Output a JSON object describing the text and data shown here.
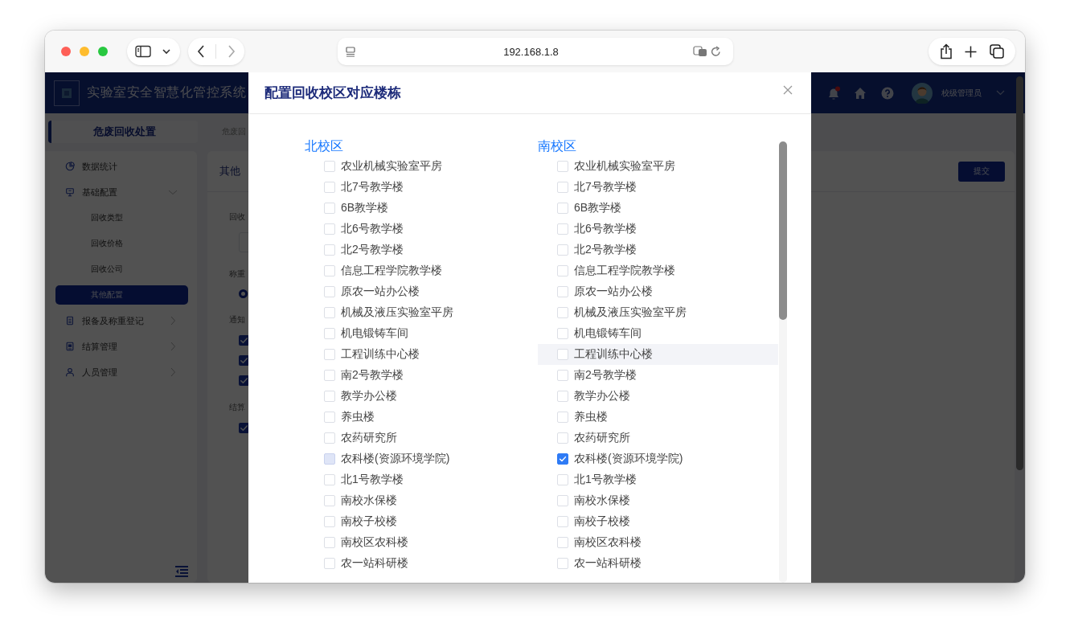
{
  "browser": {
    "url": "192.168.1.8"
  },
  "app": {
    "title": "实验室安全智慧化管控系统",
    "user": "校级管理员"
  },
  "sidebar": {
    "tab": "危废回收处置",
    "items": [
      {
        "label": "数据统计",
        "kind": "link",
        "selected": false
      },
      {
        "label": "基础配置",
        "kind": "group",
        "expanded": true,
        "selected": false,
        "children": [
          {
            "label": "回收类型",
            "selected": false
          },
          {
            "label": "回收价格",
            "selected": false
          },
          {
            "label": "回收公司",
            "selected": false
          },
          {
            "label": "其他配置",
            "selected": true
          }
        ]
      },
      {
        "label": "报备及称重登记",
        "kind": "group",
        "expanded": false,
        "selected": false
      },
      {
        "label": "结算管理",
        "kind": "group",
        "expanded": false,
        "selected": false
      },
      {
        "label": "人员管理",
        "kind": "group",
        "expanded": false,
        "selected": false
      }
    ]
  },
  "main": {
    "breadcrumb": "危废回",
    "card_title": "其他",
    "submit": "提交",
    "form": [
      {
        "label": "回收",
        "kind": "input"
      },
      {
        "label": "称重",
        "kind": "radio",
        "options": [
          {
            "selected": true
          }
        ]
      },
      {
        "label": "通知",
        "kind": "checkbox",
        "options": [
          {
            "checked": true
          },
          {
            "checked": true
          },
          {
            "checked": true
          }
        ]
      },
      {
        "label": "结算",
        "kind": "checkbox",
        "options": [
          {
            "checked": true
          }
        ]
      }
    ]
  },
  "dialog": {
    "title": "配置回收校区对应楼栋",
    "campuses": [
      {
        "name": "北校区",
        "buildings": [
          {
            "label": "农业机械实验室平房",
            "checked": false,
            "disabled": false,
            "hovered": false
          },
          {
            "label": "北7号教学楼",
            "checked": false,
            "disabled": false,
            "hovered": false
          },
          {
            "label": "6B教学楼",
            "checked": false,
            "disabled": false,
            "hovered": false
          },
          {
            "label": "北6号教学楼",
            "checked": false,
            "disabled": false,
            "hovered": false
          },
          {
            "label": "北2号教学楼",
            "checked": false,
            "disabled": false,
            "hovered": false
          },
          {
            "label": "信息工程学院教学楼",
            "checked": false,
            "disabled": false,
            "hovered": false
          },
          {
            "label": "原农一站办公楼",
            "checked": false,
            "disabled": false,
            "hovered": false
          },
          {
            "label": "机械及液压实验室平房",
            "checked": false,
            "disabled": false,
            "hovered": false
          },
          {
            "label": "机电锻铸车间",
            "checked": false,
            "disabled": false,
            "hovered": false
          },
          {
            "label": "工程训练中心楼",
            "checked": false,
            "disabled": false,
            "hovered": false
          },
          {
            "label": "南2号教学楼",
            "checked": false,
            "disabled": false,
            "hovered": false
          },
          {
            "label": "教学办公楼",
            "checked": false,
            "disabled": false,
            "hovered": false
          },
          {
            "label": "养虫楼",
            "checked": false,
            "disabled": false,
            "hovered": false
          },
          {
            "label": "农药研究所",
            "checked": false,
            "disabled": false,
            "hovered": false
          },
          {
            "label": "农科楼(资源环境学院)",
            "checked": false,
            "disabled": true,
            "hovered": false
          },
          {
            "label": "北1号教学楼",
            "checked": false,
            "disabled": false,
            "hovered": false
          },
          {
            "label": "南校水保楼",
            "checked": false,
            "disabled": false,
            "hovered": false
          },
          {
            "label": "南校子校楼",
            "checked": false,
            "disabled": false,
            "hovered": false
          },
          {
            "label": "南校区农科楼",
            "checked": false,
            "disabled": false,
            "hovered": false
          },
          {
            "label": "农一站科研楼",
            "checked": false,
            "disabled": false,
            "hovered": false
          }
        ]
      },
      {
        "name": "南校区",
        "buildings": [
          {
            "label": "农业机械实验室平房",
            "checked": false,
            "disabled": false,
            "hovered": false
          },
          {
            "label": "北7号教学楼",
            "checked": false,
            "disabled": false,
            "hovered": false
          },
          {
            "label": "6B教学楼",
            "checked": false,
            "disabled": false,
            "hovered": false
          },
          {
            "label": "北6号教学楼",
            "checked": false,
            "disabled": false,
            "hovered": false
          },
          {
            "label": "北2号教学楼",
            "checked": false,
            "disabled": false,
            "hovered": false
          },
          {
            "label": "信息工程学院教学楼",
            "checked": false,
            "disabled": false,
            "hovered": false
          },
          {
            "label": "原农一站办公楼",
            "checked": false,
            "disabled": false,
            "hovered": false
          },
          {
            "label": "机械及液压实验室平房",
            "checked": false,
            "disabled": false,
            "hovered": false
          },
          {
            "label": "机电锻铸车间",
            "checked": false,
            "disabled": false,
            "hovered": false
          },
          {
            "label": "工程训练中心楼",
            "checked": false,
            "disabled": false,
            "hovered": true
          },
          {
            "label": "南2号教学楼",
            "checked": false,
            "disabled": false,
            "hovered": false
          },
          {
            "label": "教学办公楼",
            "checked": false,
            "disabled": false,
            "hovered": false
          },
          {
            "label": "养虫楼",
            "checked": false,
            "disabled": false,
            "hovered": false
          },
          {
            "label": "农药研究所",
            "checked": false,
            "disabled": false,
            "hovered": false
          },
          {
            "label": "农科楼(资源环境学院)",
            "checked": true,
            "disabled": false,
            "hovered": false
          },
          {
            "label": "北1号教学楼",
            "checked": false,
            "disabled": false,
            "hovered": false
          },
          {
            "label": "南校水保楼",
            "checked": false,
            "disabled": false,
            "hovered": false
          },
          {
            "label": "南校子校楼",
            "checked": false,
            "disabled": false,
            "hovered": false
          },
          {
            "label": "南校区农科楼",
            "checked": false,
            "disabled": false,
            "hovered": false
          },
          {
            "label": "农一站科研楼",
            "checked": false,
            "disabled": false,
            "hovered": false
          }
        ]
      }
    ]
  }
}
